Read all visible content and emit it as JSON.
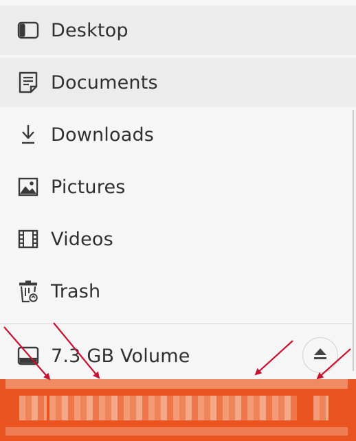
{
  "sidebar": {
    "items": [
      {
        "label": "Desktop",
        "icon": "desktop-icon"
      },
      {
        "label": "Documents",
        "icon": "document-icon"
      },
      {
        "label": "Downloads",
        "icon": "download-icon"
      },
      {
        "label": "Pictures",
        "icon": "picture-icon"
      },
      {
        "label": "Videos",
        "icon": "video-icon"
      },
      {
        "label": "Trash",
        "icon": "trash-icon"
      }
    ],
    "volume": {
      "label": "7.3 GB Volume",
      "icon": "drive-icon",
      "action_icon": "eject-icon"
    }
  },
  "colors": {
    "selection": "#e95420",
    "annotation_arrow": "#c8102e"
  }
}
